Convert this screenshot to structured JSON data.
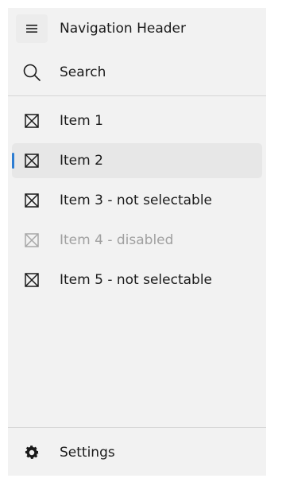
{
  "header": {
    "menu_icon": "hamburger-icon",
    "title": "Navigation Header"
  },
  "search": {
    "icon": "search-icon",
    "label": "Search"
  },
  "items": [
    {
      "label": "Item 1",
      "icon": "box-x-icon",
      "state": "normal"
    },
    {
      "label": "Item 2",
      "icon": "box-x-icon",
      "state": "selected"
    },
    {
      "label": "Item 3 - not selectable",
      "icon": "box-x-icon",
      "state": "normal"
    },
    {
      "label": "Item 4 - disabled",
      "icon": "box-x-icon",
      "state": "disabled"
    },
    {
      "label": "Item 5 - not selectable",
      "icon": "box-x-icon",
      "state": "normal"
    }
  ],
  "footer": {
    "icon": "gear-icon",
    "label": "Settings"
  },
  "colors": {
    "pane_background": "#f2f2f2",
    "selected_background": "#e7e7e7",
    "accent": "#2d7dd2",
    "disabled_text": "#a0a0a0"
  }
}
